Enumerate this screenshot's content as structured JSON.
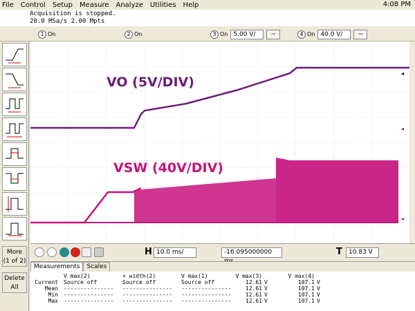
{
  "menu": {
    "items": [
      "File",
      "Control",
      "Setup",
      "Measure",
      "Analyze",
      "Utilities",
      "Help"
    ],
    "clock": "4:08 PM"
  },
  "status": {
    "line1": "Acquisition is stopped.",
    "line2": "20.0 MSa/s   2.00 Mpts"
  },
  "channels": [
    {
      "num": "1",
      "state": "On",
      "scale": "",
      "coupling": ""
    },
    {
      "num": "2",
      "state": "On",
      "scale": "",
      "coupling": ""
    },
    {
      "num": "3",
      "state": "On",
      "scale": "5.00 V/",
      "coupling": "~"
    },
    {
      "num": "4",
      "state": "On",
      "scale": "40.0 V/",
      "coupling": "~"
    }
  ],
  "palette": {
    "more_label": "More",
    "more_sub": "(1 of 2)",
    "delete_label": "Delete",
    "delete_sub": "All"
  },
  "screen": {
    "vo_label": "VO (5V/DIV)",
    "vsw_label": "VSW (40V/DIV)",
    "trace_colors": {
      "vo": "#6b1d7a",
      "vsw": "#c5137d"
    }
  },
  "timebase": {
    "h_letter": "H",
    "time_per_div": "10.0 ms/",
    "position": "-16.095000000 ms",
    "t_letter": "T",
    "trigger_level": "10.83 V"
  },
  "measurements": {
    "tabs": [
      "Measurements",
      "Scales"
    ],
    "header": [
      "",
      "V max(2)",
      "+ width(2)",
      "V max(1)",
      "V max(3)",
      "",
      "V max(4)",
      ""
    ],
    "rows": [
      [
        "Current",
        "Source off",
        "Source off",
        "Source off",
        "12.61",
        "V",
        "107.1",
        "V"
      ],
      [
        "Mean",
        "---------------",
        "---------------",
        "---------------",
        "12.61",
        "V",
        "107.1",
        "V"
      ],
      [
        "Min",
        "---------------",
        "---------------",
        "---------------",
        "12.61",
        "V",
        "107.1",
        "V"
      ],
      [
        "Max",
        "---------------",
        "---------------",
        "---------------",
        "12.61",
        "V",
        "107.1",
        "V"
      ]
    ]
  }
}
